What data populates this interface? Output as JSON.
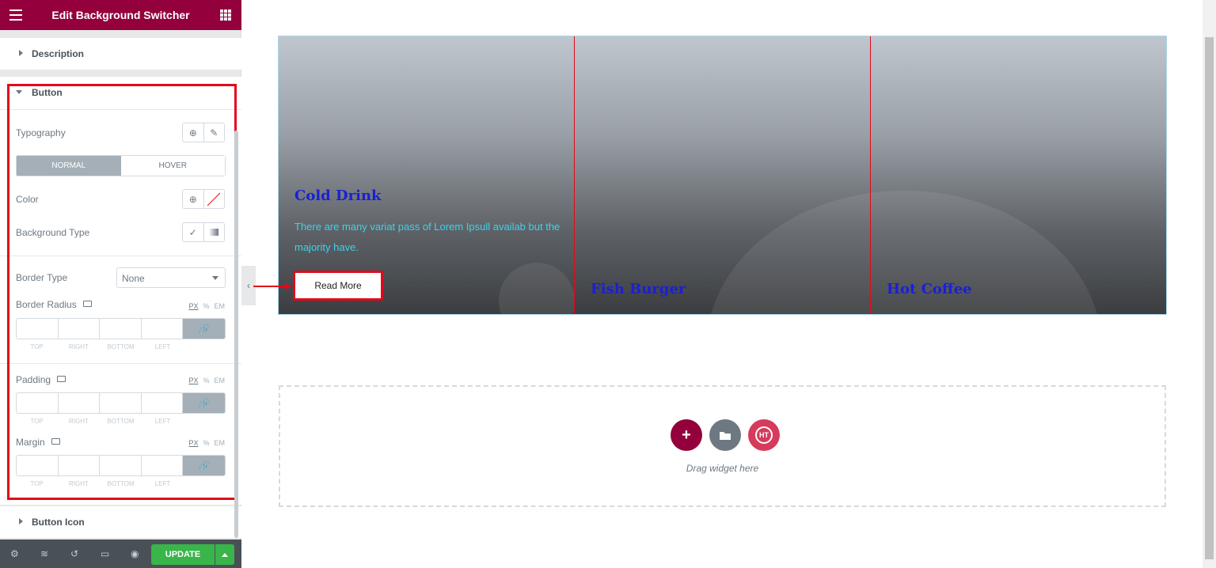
{
  "topbar": {
    "title": "Edit Background Switcher"
  },
  "sections": {
    "description": "Description",
    "button": "Button",
    "button_icon": "Button Icon"
  },
  "button_panel": {
    "typography_label": "Typography",
    "tabs": [
      "NORMAL",
      "HOVER"
    ],
    "color_label": "Color",
    "background_type_label": "Background Type",
    "border_type_label": "Border Type",
    "border_type_value": "None",
    "border_radius_label": "Border Radius",
    "padding_label": "Padding",
    "margin_label": "Margin",
    "units": [
      "PX",
      "%",
      "EM"
    ],
    "dimension_labels": [
      "TOP",
      "RIGHT",
      "BOTTOM",
      "LEFT"
    ]
  },
  "bottombar": {
    "update_label": "UPDATE"
  },
  "switcher": {
    "items": [
      {
        "title": "Cold Drink",
        "description": "There are many variat pass of Lorem Ipsull availab but the majority have."
      },
      {
        "title": "Fish Burger"
      },
      {
        "title": "Hot Coffee"
      }
    ],
    "button_label": "Read More",
    "colors": {
      "title": "#1a1fd6",
      "description": "#42d0e8",
      "highlight": "#e2091b"
    }
  },
  "drop_zone": {
    "text": "Drag widget here",
    "ht_label": "HT"
  },
  "colors": {
    "brand": "#93003c",
    "update": "#39b54a",
    "ht": "#d63b5c",
    "folder": "#6d7882"
  }
}
